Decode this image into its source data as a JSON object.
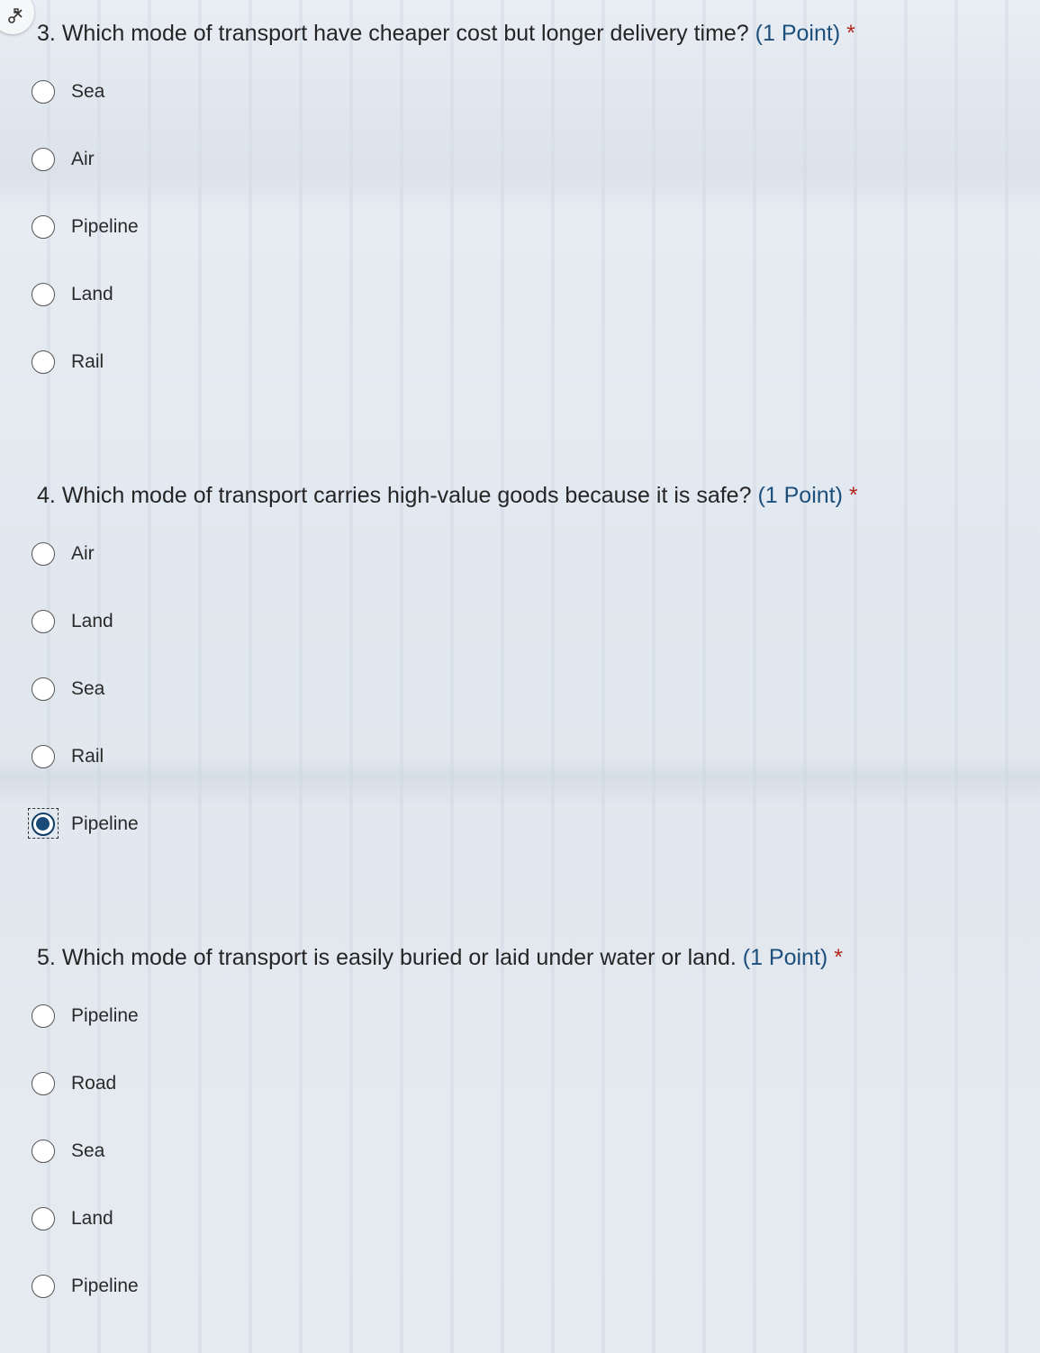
{
  "questions": [
    {
      "number": "3.",
      "text": "Which mode of transport have cheaper cost but longer delivery time?",
      "points": "(1 Point)",
      "required": "*",
      "options": [
        "Sea",
        "Air",
        "Pipeline",
        "Land",
        "Rail"
      ],
      "selected": null
    },
    {
      "number": "4.",
      "text": "Which mode of transport carries high-value goods because it is safe?",
      "points": "(1 Point)",
      "required": "*",
      "options": [
        "Air",
        "Land",
        "Sea",
        "Rail",
        "Pipeline"
      ],
      "selected": "Pipeline"
    },
    {
      "number": "5.",
      "text": "Which mode of transport is easily buried or laid under water or land.",
      "points": "(1 Point)",
      "required": "*",
      "options": [
        "Pipeline",
        "Road",
        "Sea",
        "Land",
        "Pipeline"
      ],
      "selected": null
    }
  ],
  "icons": {
    "corner": "scissors-icon"
  },
  "colors": {
    "points": "#1d4f7c",
    "required": "#b3261e",
    "selected_radio": "#1a4a78"
  }
}
